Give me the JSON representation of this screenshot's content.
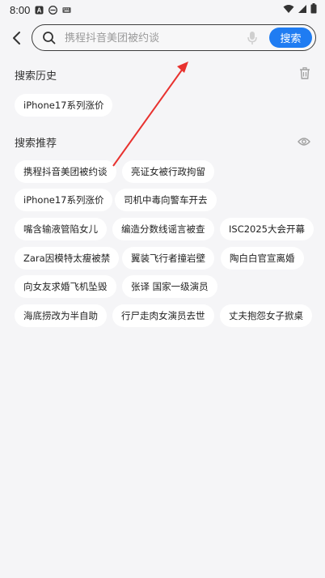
{
  "status_bar": {
    "time": "8:00",
    "left_icons": [
      "a-app-icon",
      "e-app-icon",
      "keyboard-icon"
    ],
    "right_icons": [
      "wifi-icon",
      "signal-icon",
      "battery-icon"
    ]
  },
  "search": {
    "placeholder": "携程抖音美团被约谈",
    "button_label": "搜索"
  },
  "history": {
    "title": "搜索历史",
    "items": [
      "iPhone17系列涨价"
    ]
  },
  "recommend": {
    "title": "搜索推荐",
    "rows": [
      [
        "携程抖音美团被约谈",
        "亮证女被行政拘留"
      ],
      [
        "iPhone17系列涨价",
        "司机中毒向警车开去"
      ],
      [
        "嘴含输液管陷女儿",
        "编造分数线谣言被查",
        "ISC2025大会开幕"
      ],
      [
        "Zara因模特太瘦被禁",
        "翼装飞行者撞岩壁",
        "陶白白官宣离婚"
      ],
      [
        "向女友求婚飞机坠毁",
        "张译 国家一级演员"
      ],
      [
        "海底捞改为半自助",
        "行尸走肉女演员去世",
        "丈夫抱怨女子掀桌"
      ]
    ]
  },
  "colors": {
    "accent": "#1f7cf2",
    "background": "#f5f5f7",
    "chip": "#ffffff",
    "annotation_arrow": "#e8322f"
  }
}
